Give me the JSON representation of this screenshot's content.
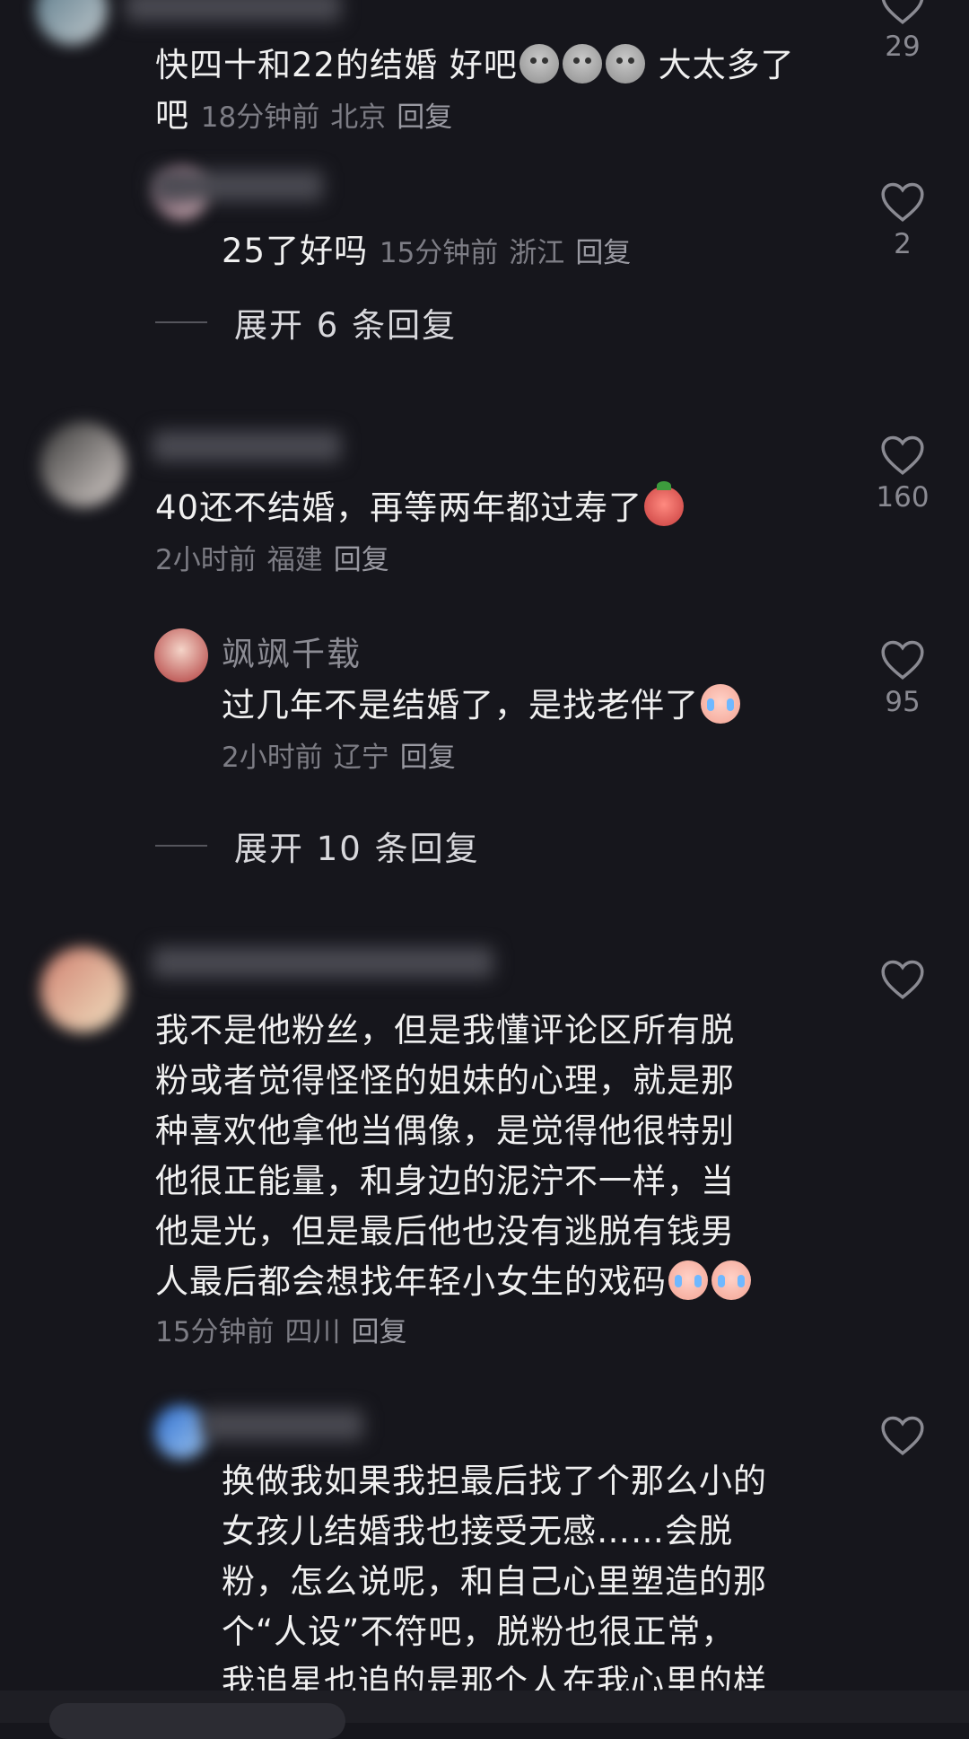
{
  "colors": {
    "background": "#16161c",
    "text": "#f0f0f0",
    "meta": "#7d7d85"
  },
  "comments": [
    {
      "text": "快四十和22的结婚 好吧",
      "emoji": [
        "ghost-emoji",
        "ghost-emoji",
        "ghost-emoji"
      ],
      "text_after": " 大太多了吧",
      "time": "18分钟前",
      "location": "北京",
      "reply": "回复",
      "likes": "29"
    },
    {
      "text": "25了好吗",
      "time": "15分钟前",
      "location": "浙江",
      "reply": "回复",
      "likes": "2"
    },
    {
      "expand": "展开 6 条回复"
    },
    {
      "text": "40还不结婚，再等两年都过寿了",
      "emoji": [
        "angry-emoji"
      ],
      "time": "2小时前",
      "location": "福建",
      "reply": "回复",
      "likes": "160"
    },
    {
      "username": "飒飒千载",
      "text": "过几年不是结婚了，是找老伴了",
      "emoji": [
        "cry-emoji"
      ],
      "time": "2小时前",
      "location": "辽宁",
      "reply": "回复",
      "likes": "95"
    },
    {
      "expand": "展开 10 条回复"
    },
    {
      "lines": [
        "我不是他粉丝，但是我懂评论区所有脱",
        "粉或者觉得怪怪的姐妹的心理，就是那",
        "种喜欢他拿他当偶像，是觉得他很特别",
        "他很正能量，和身边的泥泞不一样，当",
        "他是光，但是最后他也没有逃脱有钱男",
        "人最后都会想找年轻小女生的戏码"
      ],
      "emoji": [
        "cry-emoji",
        "cry-emoji"
      ],
      "time": "15分钟前",
      "location": "四川",
      "reply": "回复"
    },
    {
      "lines": [
        "换做我如果我担最后找了个那么小的",
        "女孩儿结婚我也接受无感……会脱",
        "粉，怎么说呢，和自己心里塑造的那",
        "个“人设”不符吧，脱粉也很正常，",
        "我追星也追的是那个人在我心里的样"
      ]
    }
  ]
}
